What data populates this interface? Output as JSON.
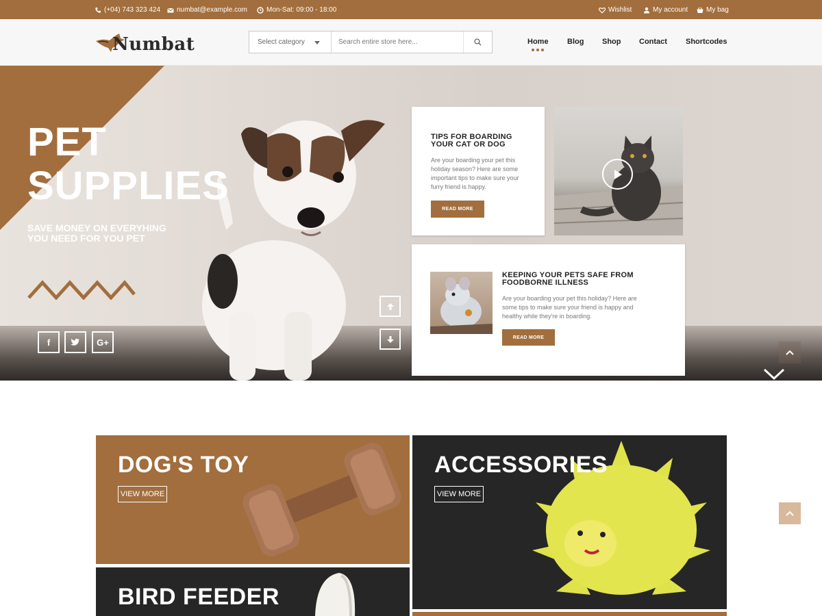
{
  "topbar": {
    "phone": "(+04) 743 323 424",
    "email": "numbat@example.com",
    "hours": "Mon-Sat: 09:00 - 18:00",
    "wishlist": "Wishlist",
    "account": "My account",
    "bag": "My bag"
  },
  "header": {
    "logo_text": "Numbat",
    "search": {
      "category": "Select category",
      "placeholder": "Search entire store here..."
    },
    "nav": [
      "Home",
      "Blog",
      "Shop",
      "Contact",
      "Shortcodes"
    ],
    "active_nav": "Home"
  },
  "hero": {
    "title_line1": "PET",
    "title_line2": "SUPPLIES",
    "subtitle_line1": "SAVE MONEY ON EVERYHING",
    "subtitle_line2": "YOU NEED FOR YOU PET",
    "social": [
      "f",
      "t",
      "G+"
    ]
  },
  "posts": [
    {
      "title_line1": "TIPS FOR BOARDING",
      "title_line2": "YOUR CAT OR DOG",
      "text_lines": [
        "Are your boarding your pet this",
        "holiday season? Here are some",
        "important tips to make sure your",
        "furry friend is happy."
      ],
      "button": "READ MORE"
    },
    {
      "title_line1": "KEEPING YOUR PETS SAFE FROM",
      "title_line2": "FOODBORNE ILLNESS",
      "text_lines": [
        "Are your boarding your pet this holiday? Here are",
        "some tips to make sure your friend is happy and",
        "healthy while they're in boarding."
      ],
      "button": "READ MORE"
    }
  ],
  "categories": [
    {
      "title": "DOG'S TOY",
      "button": "VIEW MORE"
    },
    {
      "title": "ACCESSORIES",
      "button": "VIEW MORE"
    },
    {
      "title": "BIRD FEEDER"
    }
  ],
  "colors": {
    "brand": "#a26e3d",
    "dark": "#262626",
    "accent_light": "#d8b99b"
  }
}
